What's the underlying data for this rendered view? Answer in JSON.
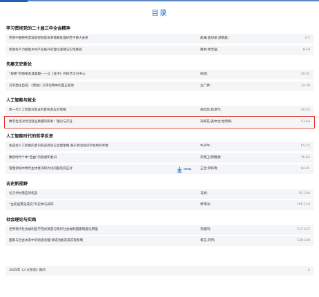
{
  "title": "目录",
  "sections": [
    {
      "heading": "学习贯彻党的二十届三中全会精神",
      "entries": [
        {
          "title": "完善中国特色宏观调控制度体系需要处理好若干重大关系",
          "authors": "赵巍;匡桢泉;邵雨晨;",
          "pages": "1-7"
        },
        {
          "title": "新质生产力赋能乡村产业振兴的理论逻辑与实现路径",
          "authors": "路琳;余晋容;",
          "pages": "8-19"
        }
      ]
    },
    {
      "heading": "先秦文史新论",
      "entries": [
        {
          "title": "“规矩”的隐喻及其超越——以《庄子》的技艺论为中心",
          "authors": "徐翔;",
          "pages": "20-31"
        },
        {
          "title": "汉字西化自成：《周易》汉字诠释中的圣王叙述",
          "authors": "企广秀;",
          "pages": "32-39"
        }
      ]
    },
    {
      "heading": "人工智能与就业",
      "entries": [
        {
          "title": "新一代人工智能对就业的影响及应对策略",
          "authors": "胡昌昌;程承玲;",
          "pages": "40-52"
        },
        {
          "title": "数字生活对灵活就业质量的影响：理论与实证",
          "authors": "刘翠花;姜中达;杜雨辉;",
          "pages": "53-64",
          "highlight": true
        }
      ]
    },
    {
      "heading": "人工智能时代的哲学反思",
      "entries": [
        {
          "title": "生成式人工智能的意识形态风险与治理策略:基于政治经济学批判的考察",
          "authors": "牛子牛;",
          "pages": "65-75"
        },
        {
          "title": "数智时代个体“自由”的隐退和复归",
          "authors": "宗晓卫;韩瑾澳;",
          "pages": "76-83"
        },
        {
          "title": "管理领域中青年主体意识碎片化问题及其应对",
          "authors": "王哲;李梓青;",
          "pages": "84-91",
          "download": true
        }
      ]
    },
    {
      "heading": "古史新视野",
      "entries": [
        {
          "title": "论汉代村落空间构造",
          "authors": "马新;",
          "pages": "92-104"
        },
        {
          "title": "“古史层累造成说”的史体与异同",
          "authors": "郭伟涛;",
          "pages": "105-116"
        }
      ]
    },
    {
      "heading": "社会理论与实践",
      "entries": [
        {
          "title": "世界现代社会福利哲学范式演变与现代社会福利国家制度化原理",
          "authors": "刘继同;",
          "pages": "117-127"
        },
        {
          "title": "国家与社会关系中的街道治理:调适功能及其实现机制",
          "authors": "蒋志;刘伟;",
          "pages": "128-140"
        }
      ]
    }
  ],
  "footer_entry": {
    "title": "2025年《人文杂志》稿约",
    "authors": "",
    "pages": "2"
  },
  "download_badge": "HTML",
  "colors": {
    "accent": "#2d6ac4",
    "highlight": "#e0302b",
    "entry_bg": "#f4f5f7"
  },
  "icons": {
    "download": "download-icon"
  }
}
